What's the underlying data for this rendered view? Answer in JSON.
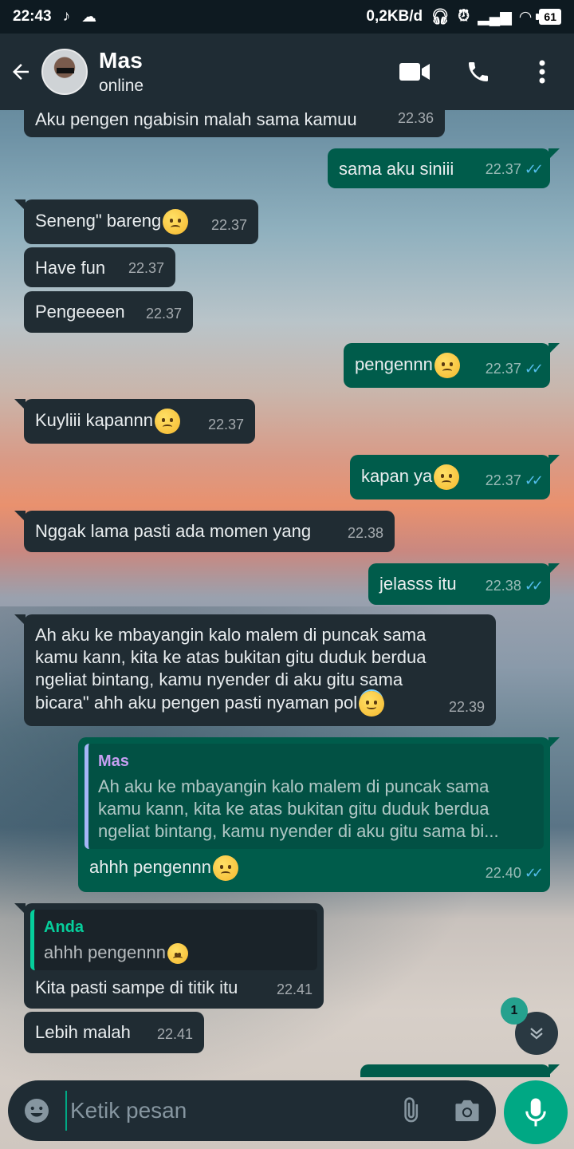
{
  "status_bar": {
    "time": "22:43",
    "network_speed": "0,2KB/d",
    "battery": "61"
  },
  "header": {
    "contact_name": "Mas",
    "contact_status": "online"
  },
  "messages": [
    {
      "dir": "in",
      "text": "Aku pengen ngabisin malah sama kamuu",
      "time": "22.36"
    },
    {
      "dir": "out",
      "text": "sama aku siniii",
      "time": "22.37"
    },
    {
      "dir": "in",
      "text": "Seneng\" bareng",
      "emoji": "disappointed",
      "time": "22.37"
    },
    {
      "dir": "in",
      "text": "Have fun",
      "time": "22.37"
    },
    {
      "dir": "in",
      "text": "Pengeeeen",
      "time": "22.37"
    },
    {
      "dir": "out",
      "text": "pengennn",
      "emoji": "disappointed",
      "time": "22.37"
    },
    {
      "dir": "in",
      "text": "Kuyliii kapannn",
      "emoji": "disappointed",
      "time": "22.37"
    },
    {
      "dir": "out",
      "text": "kapan ya",
      "emoji": "disappointed",
      "time": "22.37"
    },
    {
      "dir": "in",
      "text": "Nggak lama pasti ada momen yang",
      "time": "22.38"
    },
    {
      "dir": "out",
      "text": "jelasss itu",
      "time": "22.38"
    },
    {
      "dir": "in",
      "lines": [
        "Ah aku ke mbayangin kalo malem di puncak sama",
        "kamu kann, kita ke atas bukitan gitu duduk berdua",
        "ngeliat bintang, kamu nyender di aku gitu sama",
        "bicara\" ahh aku pengen pasti nyaman pol"
      ],
      "emoji": "innocent",
      "time": "22.39"
    },
    {
      "dir": "out",
      "quote_author": "Mas",
      "quote_lines": [
        "Ah aku ke mbayangin kalo malem di puncak sama",
        "kamu kann, kita ke atas bukitan gitu duduk berdua",
        "ngeliat bintang, kamu nyender di aku gitu sama bi..."
      ],
      "text": "ahhh pengennn",
      "emoji": "disappointed",
      "time": "22.40"
    },
    {
      "dir": "in",
      "quote_author": "Anda",
      "quote_text": "ahhh pengennn",
      "quote_emoji": "disappointed",
      "text": "Kita pasti sampe di titik itu",
      "time": "22.41"
    },
    {
      "dir": "in",
      "text": "Lebih malah",
      "time": "22.41"
    }
  ],
  "scroll_button": {
    "unread_count": "1"
  },
  "composer": {
    "placeholder": "Ketik pesan"
  },
  "icons": {
    "back": "arrow-left-icon",
    "video": "video-call-icon",
    "voice": "phone-icon",
    "menu": "more-vertical-icon",
    "emoji": "emoji-icon",
    "attach": "paperclip-icon",
    "camera": "camera-icon",
    "mic": "microphone-icon"
  },
  "colors": {
    "header_bg": "#1f2c34",
    "incoming_bubble": "#202c33",
    "outgoing_bubble": "#005c4b",
    "read_ticks": "#53bdeb",
    "accent": "#00a884"
  }
}
